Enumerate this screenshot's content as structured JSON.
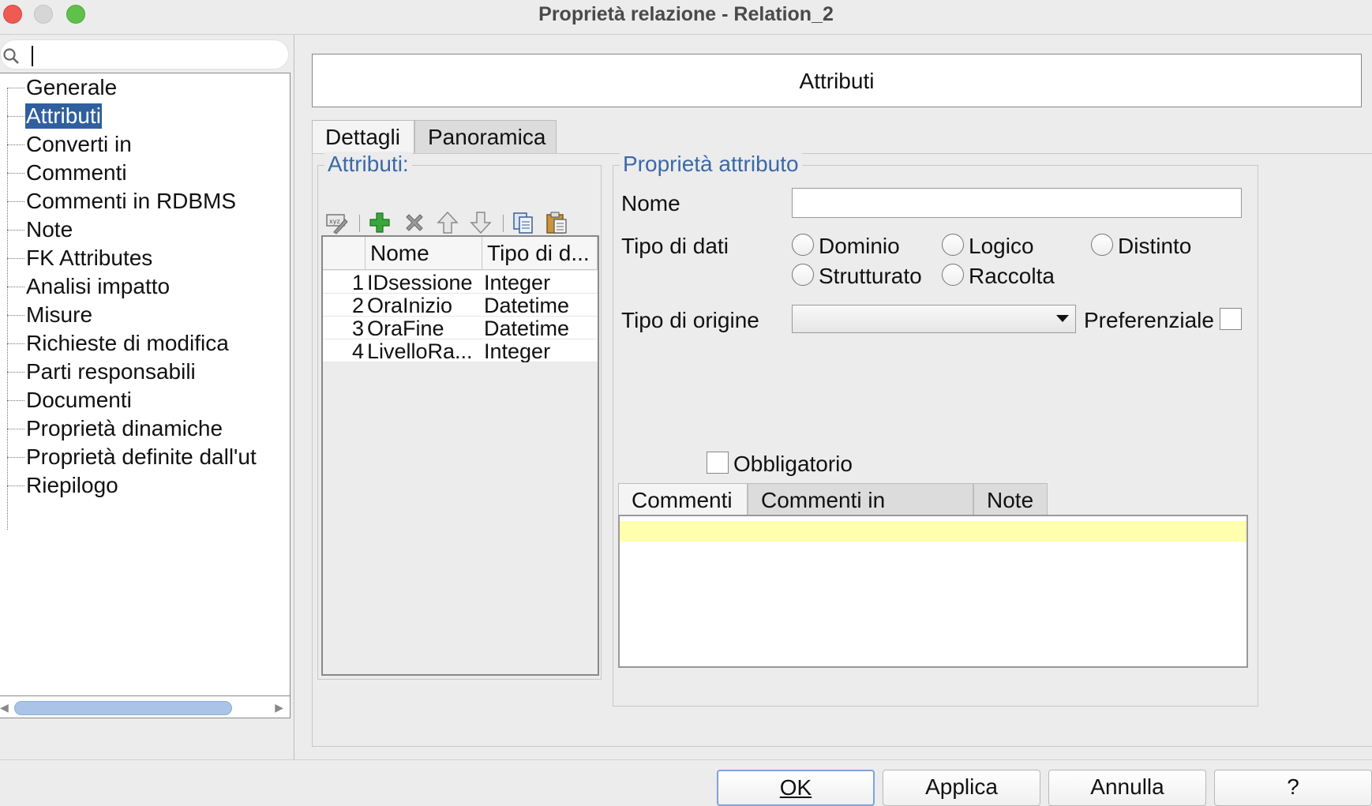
{
  "window": {
    "title": "Proprietà relazione - Relation_2"
  },
  "search": {
    "value": ""
  },
  "sidebar": {
    "items": [
      {
        "label": "Generale"
      },
      {
        "label": "Attributi"
      },
      {
        "label": "Converti in"
      },
      {
        "label": "Commenti"
      },
      {
        "label": "Commenti in RDBMS"
      },
      {
        "label": "Note"
      },
      {
        "label": "FK Attributes"
      },
      {
        "label": "Analisi impatto"
      },
      {
        "label": "Misure"
      },
      {
        "label": "Richieste di modifica"
      },
      {
        "label": "Parti responsabili"
      },
      {
        "label": "Documenti"
      },
      {
        "label": "Proprietà dinamiche"
      },
      {
        "label": "Proprietà definite dall'ut"
      },
      {
        "label": "Riepilogo"
      }
    ],
    "selected": "Attributi"
  },
  "header": {
    "title": "Attributi"
  },
  "tabs": {
    "details": "Dettagli",
    "overview": "Panoramica"
  },
  "attributes_group": {
    "title": "Attributi:",
    "toolbar_icons": [
      "edit-icon",
      "add-icon",
      "delete-icon",
      "move-up-icon",
      "move-down-icon",
      "copy-icon",
      "paste-icon"
    ],
    "columns": [
      "",
      "Nome",
      "Tipo di d..."
    ],
    "rows": [
      {
        "num": "1",
        "name": "IDsessione",
        "type": "Integer"
      },
      {
        "num": "2",
        "name": "OraInizio",
        "type": "Datetime"
      },
      {
        "num": "3",
        "name": "OraFine",
        "type": "Datetime"
      },
      {
        "num": "4",
        "name": "LivelloRa...",
        "type": "Integer"
      }
    ]
  },
  "properties_group": {
    "title": "Proprietà attributo",
    "name_label": "Nome",
    "name_value": "",
    "data_type_label": "Tipo di dati",
    "data_types": [
      "Dominio",
      "Logico",
      "Distinto",
      "Strutturato",
      "Raccolta"
    ],
    "source_type_label": "Tipo di origine",
    "source_type_value": "",
    "preferential_label": "Preferenziale",
    "mandatory_label": "Obbligatorio"
  },
  "comment_tabs": [
    "Commenti",
    "Commenti in RDBMS",
    "Note"
  ],
  "footer": {
    "ok": "OK",
    "apply": "Applica",
    "cancel": "Annulla",
    "help": "?"
  },
  "colors": {
    "accent": "#3c68a8",
    "selection": "#2f5f9e",
    "highlight": "#ffffad"
  }
}
